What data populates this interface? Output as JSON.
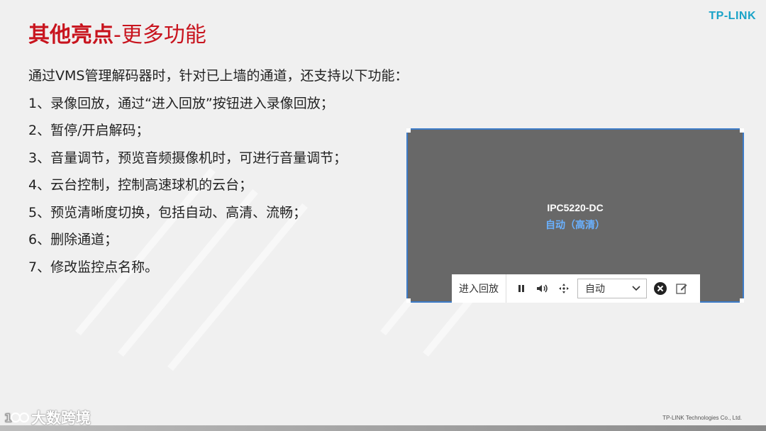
{
  "header": {
    "logo": "TP-LINK",
    "title_main": "其他亮点",
    "title_sub": "-更多功能"
  },
  "content": {
    "lines": [
      "通过VMS管理解码器时，针对已上墙的通道，还支持以下功能：",
      "1、录像回放，通过“进入回放”按钮进入录像回放；",
      "2、暂停/开启解码；",
      "3、音量调节，预览音频摄像机时，可进行音量调节；",
      "4、云台控制，控制高速球机的云台；",
      "5、预览清晰度切换，包括自动、高清、流畅；",
      "6、删除通道；",
      "7、修改监控点名称。"
    ]
  },
  "panel": {
    "camera_name": "IPC5220-DC",
    "quality_status": "自动（高清）",
    "toolbar": {
      "playback_label": "进入回放",
      "quality_selected": "自动"
    },
    "icons": [
      "pause-icon",
      "volume-icon",
      "ptz-move-icon",
      "chevron-down-icon",
      "close-circle-icon",
      "rename-edit-icon"
    ]
  },
  "footer": {
    "company": "TP-LINK Technologies Co., Ltd.",
    "brand_watermark": "大数跨境"
  },
  "colors": {
    "title_red": "#c8141e",
    "logo_blue": "#1aa3c8",
    "panel_border": "#3d7cc9",
    "quality_blue": "#6ab1ff"
  }
}
